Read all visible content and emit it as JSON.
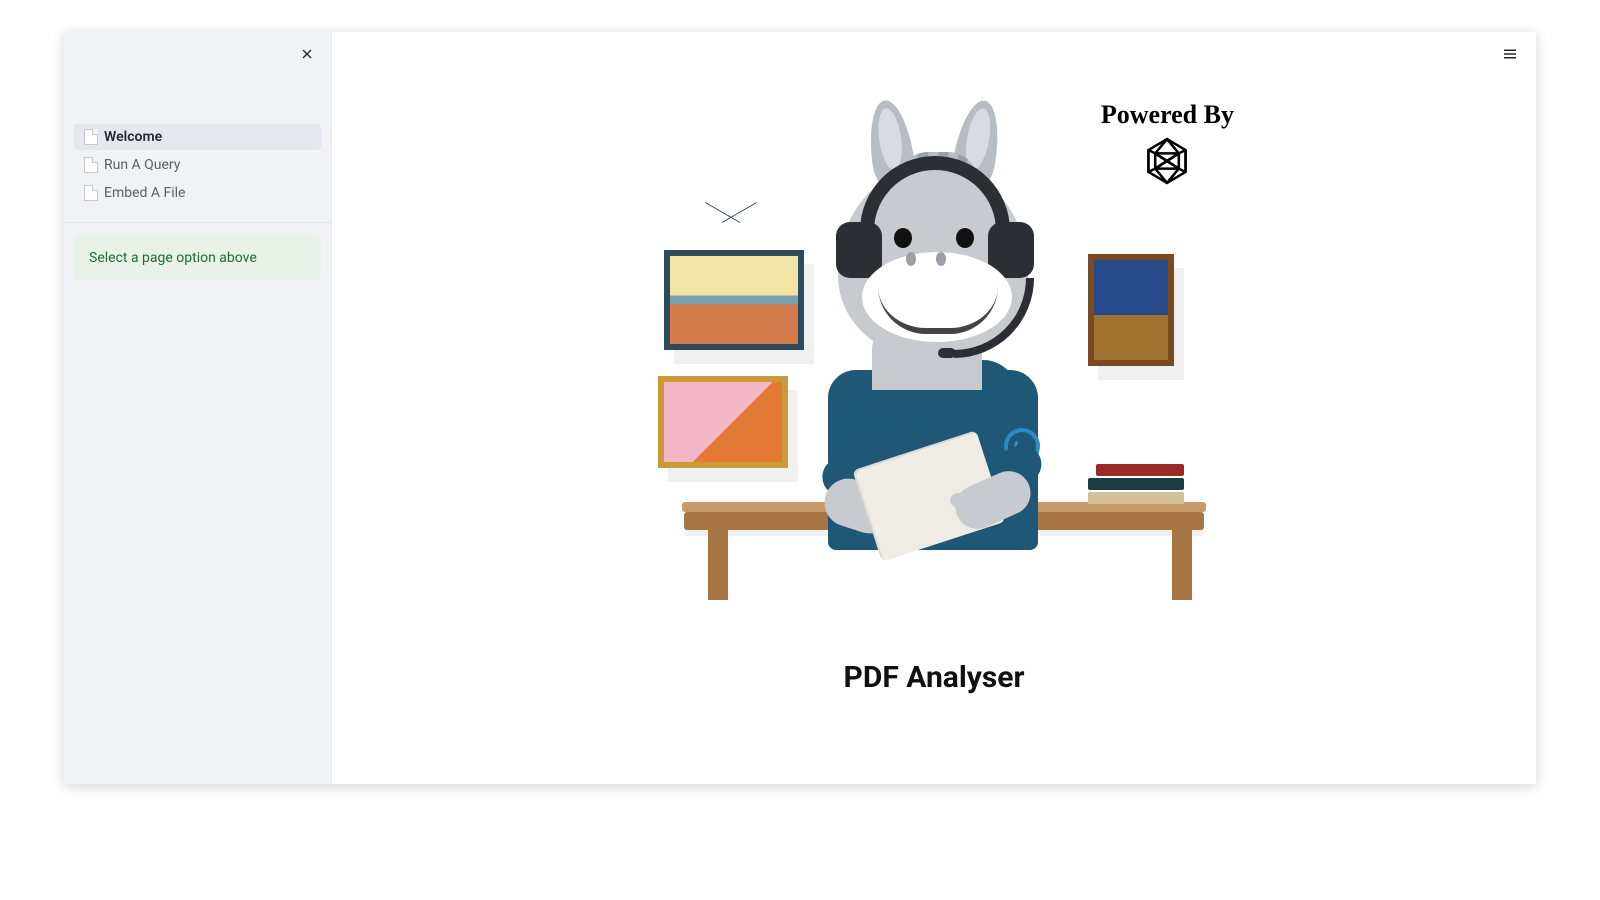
{
  "sidebar": {
    "items": [
      {
        "label": "Welcome",
        "active": true
      },
      {
        "label": "Run A Query",
        "active": false
      },
      {
        "label": "Embed A File",
        "active": false
      }
    ],
    "hint": "Select a page option above"
  },
  "main": {
    "title": "PDF Analyser",
    "powered_by_label": "Powered By",
    "logo": "openai-logo"
  }
}
